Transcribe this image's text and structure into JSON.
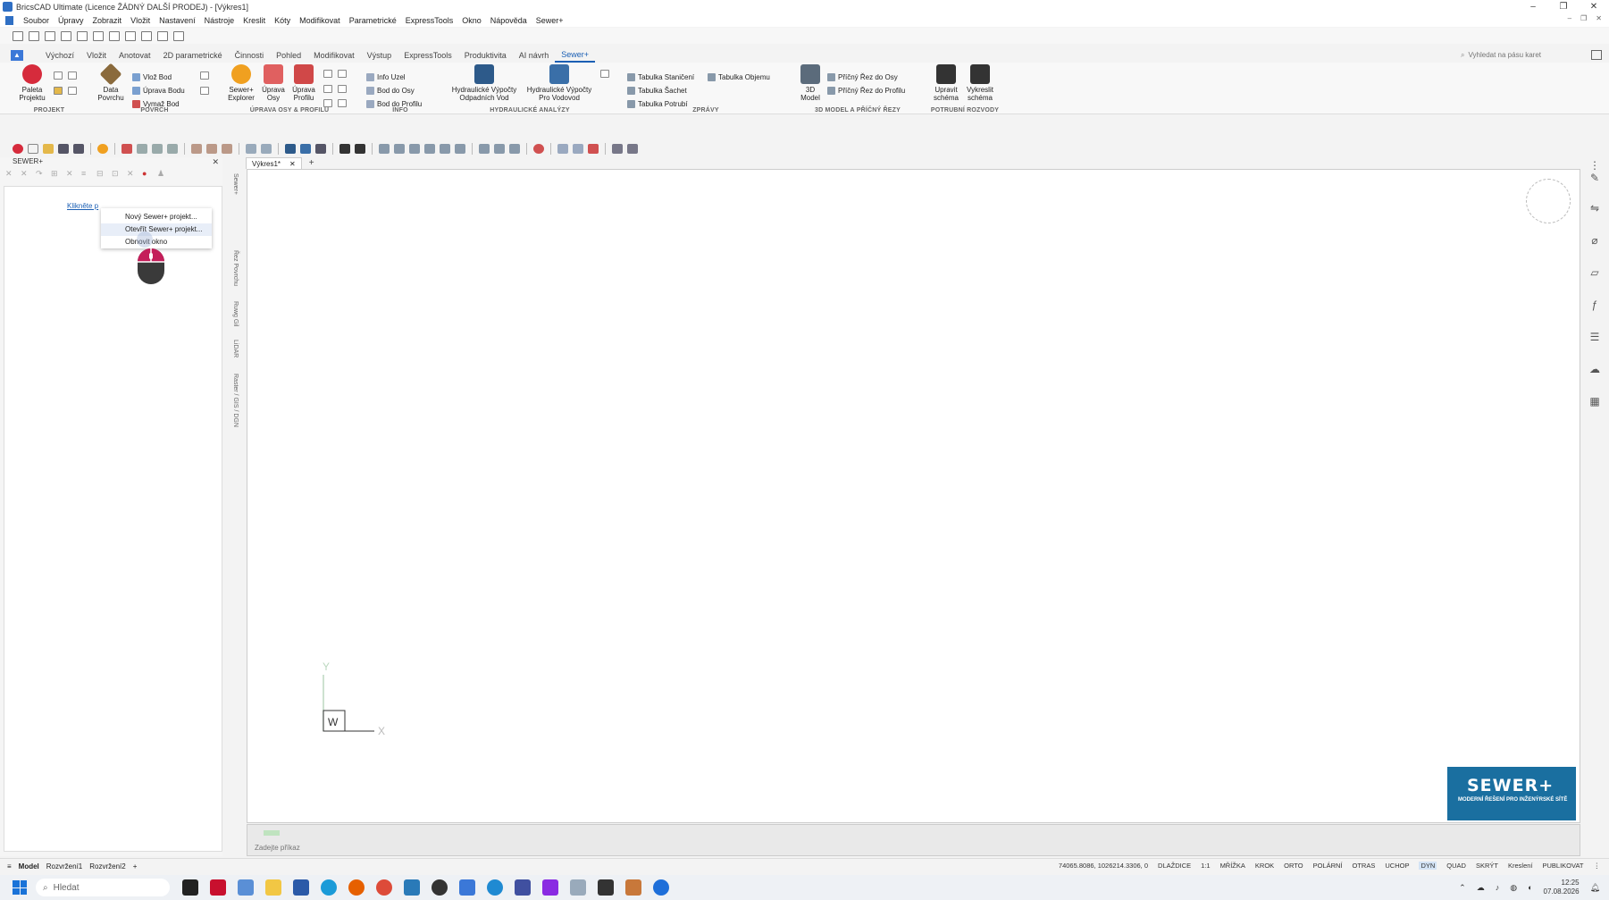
{
  "window": {
    "title": "BricsCAD Ultimate (Licence ŽÁDNÝ DALŠÍ PRODEJ) - [Výkres1]",
    "controls": [
      "–",
      "❐",
      "✕"
    ]
  },
  "menu": [
    "Soubor",
    "Úpravy",
    "Zobrazit",
    "Vložit",
    "Nastavení",
    "Nástroje",
    "Kreslit",
    "Kóty",
    "Modifikovat",
    "Parametrické",
    "ExpressTools",
    "Okno",
    "Nápověda",
    "Sewer+"
  ],
  "ribbon_tabs": [
    "Výchozí",
    "Vložit",
    "Anotovat",
    "2D parametrické",
    "Činnosti",
    "Pohled",
    "Modifikovat",
    "Výstup",
    "ExpressTools",
    "Produktivita",
    "AI návrh",
    "Sewer+"
  ],
  "ribbon_active_tab": "Sewer+",
  "search": {
    "placeholder": "Vyhledat na pásu karet"
  },
  "ribbon": {
    "projekt": {
      "label": "PROJEKT",
      "paleta": "Paleta Projektu"
    },
    "povrch": {
      "label": "POVRCH",
      "data": "Data Povrchu",
      "vloz": "Vlož Bod",
      "uprava": "Úprava Bodu",
      "vymaz": "Vymaž Bod"
    },
    "osa": {
      "label": "ÚPRAVA OSY & PROFILU",
      "explorer": "Sewer+ Explorer",
      "osy": "Úprava Osy",
      "profilu": "Úprava Profilu"
    },
    "info": {
      "label": "INFO",
      "uzel": "Info Uzel",
      "osy": "Bod do Osy",
      "profilu": "Bod do Profilu"
    },
    "hydro": {
      "label": "HYDRAULICKÉ ANALÝZY",
      "odpadni": "Hydraulické Výpočty Odpadních Vod",
      "vodovod": "Hydraulické Výpočty Pro Vodovod"
    },
    "zpravy": {
      "label": "ZPRÁVY",
      "stanic": "Tabulka Staničení",
      "objemu": "Tabulka Objemu",
      "sachet": "Tabulka Šachet",
      "potrubi": "Tabulka Potrubí"
    },
    "model": {
      "label": "3D MODEL A PŘÍČNÝ ŘEZY",
      "model3d": "3D Model",
      "rez_osy": "Příčný Řez do Osy",
      "rez_prof": "Příčný Řez do Profilu"
    },
    "rozvody": {
      "label": "POTRUBNÍ ROZVODY",
      "upravit": "Upravit schéma",
      "vykreslit": "Vykreslit schéma"
    }
  },
  "left_panel": {
    "title": "SEWER+",
    "close": "✕",
    "link": "Klikněte p",
    "context_menu": [
      "Nový Sewer+ projekt...",
      "Otevřít Sewer+ projekt...",
      "Obnovit okno"
    ]
  },
  "vertical_tabs": [
    "Sewer+",
    "Řez Povrchu",
    "Ruwg Gil",
    "LiDAR",
    "Raster / GIS / DGN"
  ],
  "doc_tabs": {
    "active": "Výkres1*",
    "close": "✕",
    "add": "+"
  },
  "ucs": {
    "y": "Y",
    "x": "X",
    "w": "W"
  },
  "brand": {
    "name": "SEWER+",
    "tagline": "MODERNÍ ŘEŠENÍ PRO INŽENÝRSKÉ SÍTĚ"
  },
  "command": {
    "placeholder": "Zadejte příkaz"
  },
  "layout_tabs": [
    "Model",
    "Rozvržení1",
    "Rozvržení2",
    "+"
  ],
  "status": {
    "coords": "74065.8086, 1026214.3306, 0",
    "items": [
      "DLAŽDICE",
      "1:1",
      "MŘÍŽKA",
      "KROK",
      "ORTO",
      "POLÁRNÍ",
      "OTRAS",
      "UCHOP",
      "DYN",
      "QUAD",
      "SKRÝT",
      "Kreslení",
      "PUBLIKOVAT"
    ],
    "active": "DYN"
  },
  "taskbar": {
    "search": "Hledat",
    "time": "12:25",
    "date": "07.08.2026"
  },
  "colors": {
    "accent": "#1b5fb4",
    "brand_bg": "#1a6fa0"
  }
}
